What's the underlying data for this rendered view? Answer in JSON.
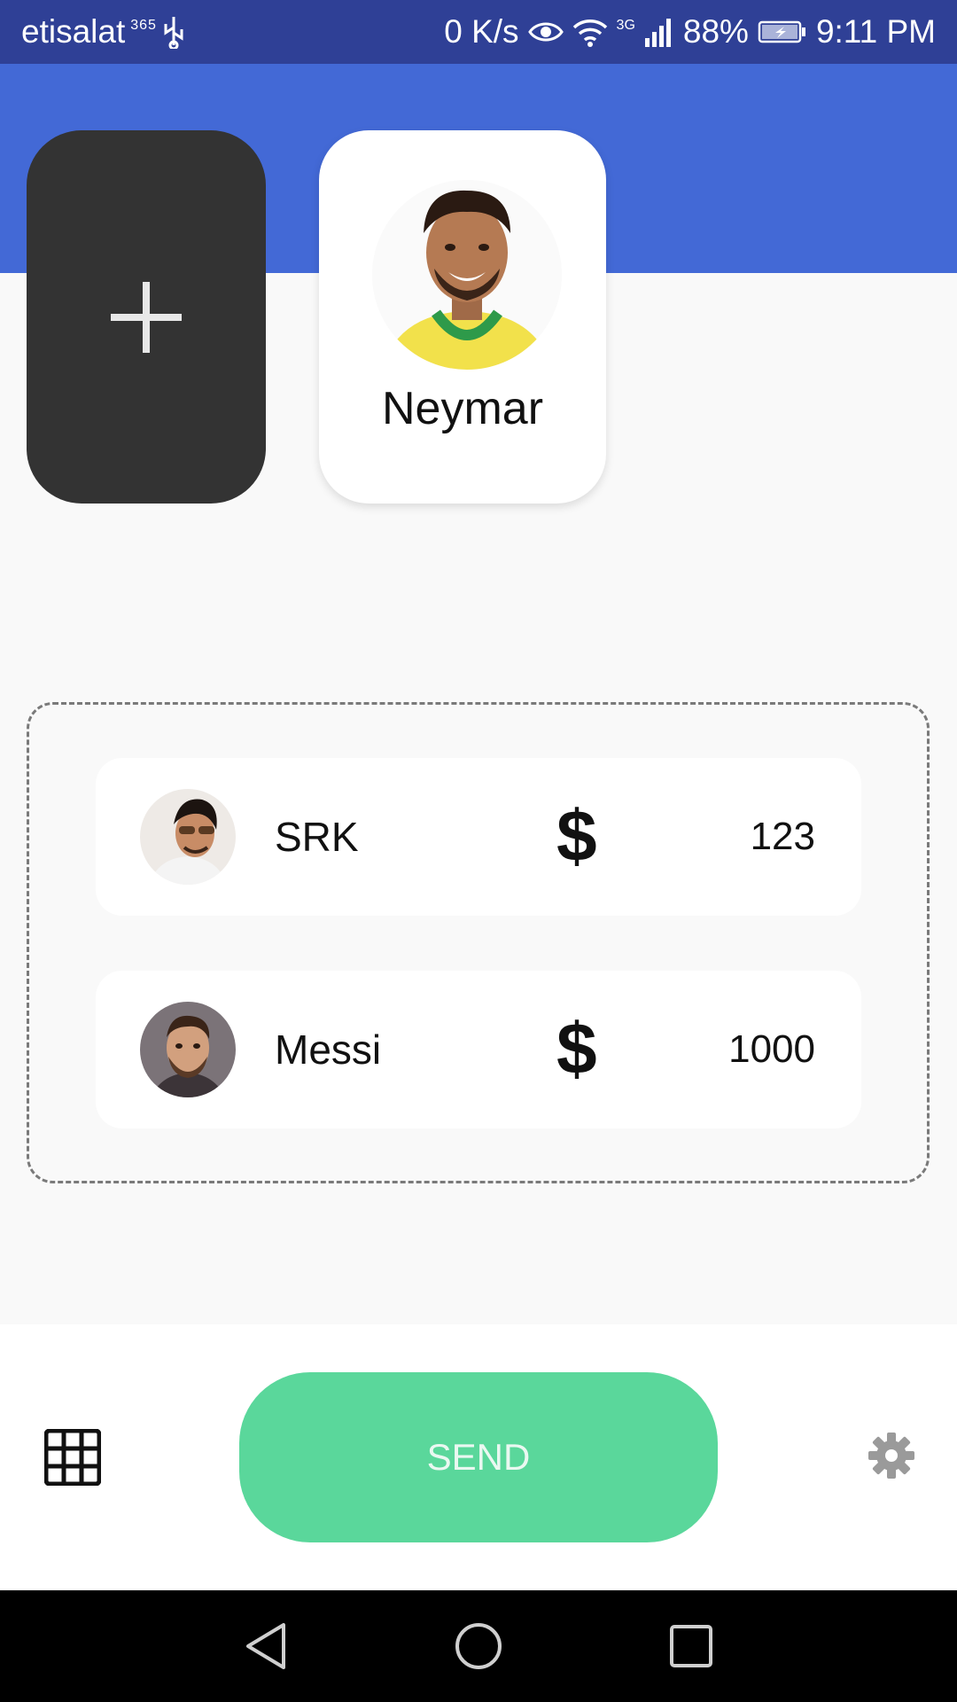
{
  "status_bar": {
    "carrier": "etisalat",
    "carrier_badge": "365",
    "speed": "0 K/s",
    "network": "3G",
    "battery": "88%",
    "time": "9:11 PM"
  },
  "add_card": {
    "icon": "plus-icon"
  },
  "selected_contact": {
    "name": "Neymar",
    "avatar": "neymar-avatar"
  },
  "recipients": [
    {
      "name": "SRK",
      "currency": "$",
      "amount": "123",
      "avatar": "srk-avatar"
    },
    {
      "name": "Messi",
      "currency": "$",
      "amount": "1000",
      "avatar": "messi-avatar"
    }
  ],
  "bottom_bar": {
    "send_label": "SEND",
    "grid_icon": "grid-icon",
    "settings_icon": "gear-icon"
  },
  "colors": {
    "status_bar": "#2f4096",
    "header": "#4369d6",
    "add_card": "#333333",
    "send_button": "#5ad79b"
  }
}
